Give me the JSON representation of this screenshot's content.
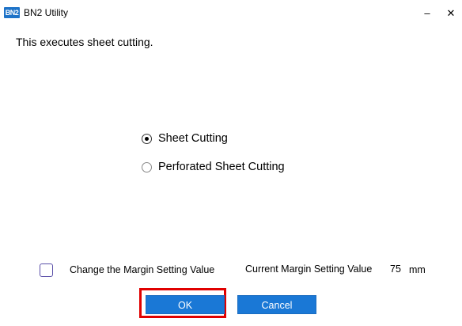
{
  "window": {
    "logo_text": "BN2",
    "title": "BN2 Utility",
    "minimize_label": "–",
    "close_label": "✕"
  },
  "dialog": {
    "message": "This executes sheet cutting.",
    "options": [
      {
        "label": "Sheet Cutting",
        "selected": true
      },
      {
        "label": "Perforated Sheet Cutting",
        "selected": false
      }
    ],
    "margin": {
      "checkbox_label": "Change the Margin Setting Value",
      "checked": false,
      "current_label": "Current Margin Setting Value",
      "current_value": "75",
      "unit": "mm"
    },
    "buttons": {
      "ok": "OK",
      "cancel": "Cancel"
    }
  },
  "colors": {
    "button_bg": "#1a78d6",
    "highlight": "#e00000",
    "checkbox_border": "#5a4fa8"
  }
}
